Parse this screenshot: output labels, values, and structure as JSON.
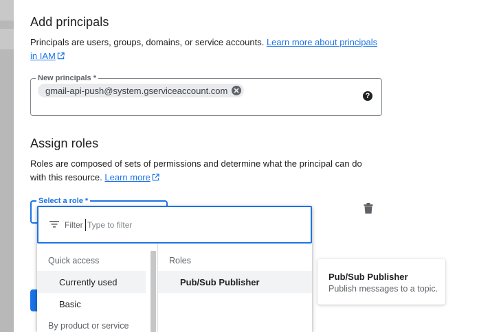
{
  "principals_section": {
    "title": "Add principals",
    "description": "Principals are users, groups, domains, or service accounts.",
    "learn_more_link": "Learn more about principals in IAM",
    "field_label": "New principals *",
    "chip_value": "gmail-api-push@system.gserviceaccount.com",
    "help_icon": "?"
  },
  "roles_section": {
    "title": "Assign roles",
    "description": "Roles are composed of sets of permissions and determine what the principal can do with this resource.",
    "learn_more_link": "Learn more",
    "role_field_label": "Select a role *"
  },
  "role_dropdown": {
    "filter_label": "Filter",
    "filter_placeholder": "Type to filter",
    "left_column": {
      "quick_access_header": "Quick access",
      "items": [
        "Currently used",
        "Basic"
      ],
      "by_product_header": "By product or service"
    },
    "right_column": {
      "header": "Roles",
      "items": [
        "Pub/Sub Publisher"
      ]
    }
  },
  "tooltip": {
    "title": "Pub/Sub Publisher",
    "description": "Publish messages to a topic."
  },
  "colors": {
    "accent": "#1a73e8",
    "text": "#202124",
    "muted": "#5f6368",
    "hover": "#f1f3f4"
  }
}
